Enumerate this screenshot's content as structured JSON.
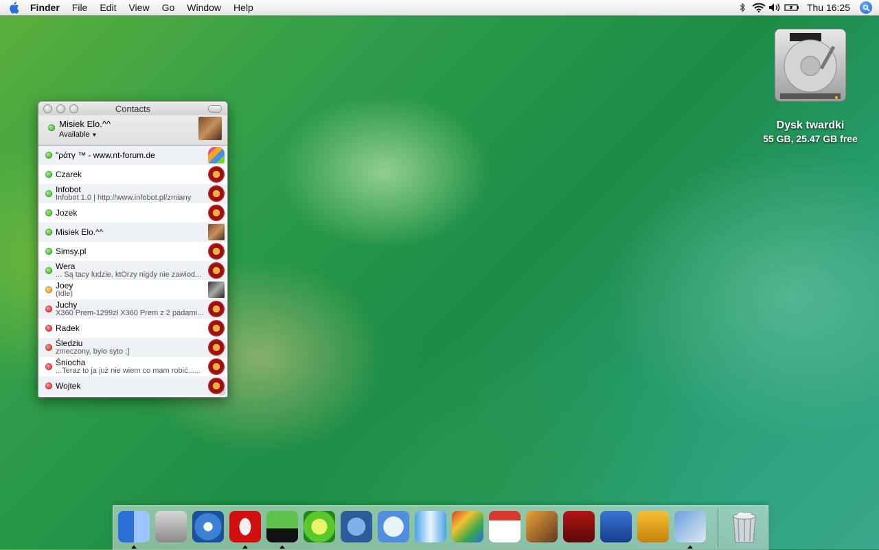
{
  "menubar": {
    "app": "Finder",
    "items": [
      "File",
      "Edit",
      "View",
      "Go",
      "Window",
      "Help"
    ],
    "clock": "Thu 16:25",
    "status_icons": [
      "bluetooth-icon",
      "wifi-icon",
      "volume-icon",
      "battery-icon"
    ]
  },
  "desktop": {
    "disk_label": "Dysk twardki",
    "disk_info": "55 GB, 25.47 GB free"
  },
  "contacts": {
    "title": "Contacts",
    "me": {
      "name": "Misiek Elo.^^",
      "status": "Available"
    },
    "list": [
      {
        "name": "\"ράτγ ™ - www.nt-forum.de",
        "msg": "",
        "status": "green",
        "icon": "butterfly"
      },
      {
        "name": "Czarek",
        "msg": "",
        "status": "green",
        "icon": "flower"
      },
      {
        "name": "Infobot",
        "msg": "Infobot 1.0 | http://www.infobot.pl/zmiany",
        "status": "green",
        "icon": "flower"
      },
      {
        "name": "Jozek",
        "msg": "",
        "status": "green",
        "icon": "flower"
      },
      {
        "name": "Misiek Elo.^^",
        "msg": "",
        "status": "green",
        "icon": "photo-a"
      },
      {
        "name": "Simsy.pl",
        "msg": "",
        "status": "green",
        "icon": "flower"
      },
      {
        "name": "Wera",
        "msg": "... Są tacy ludzie, ktÓrzy nigdy nie zawiod...",
        "status": "green",
        "icon": "flower"
      },
      {
        "name": "Joey",
        "msg": "(Idle)",
        "status": "yellow",
        "icon": "photo-b"
      },
      {
        "name": "Juchy",
        "msg": "X360 Prem-1299zł X360 Prem z 2 padami...",
        "status": "red",
        "icon": "flower"
      },
      {
        "name": "Radek",
        "msg": "",
        "status": "red",
        "icon": "flower"
      },
      {
        "name": "Śledziu",
        "msg": "zmeczony, było syto ;]",
        "status": "red",
        "icon": "flower"
      },
      {
        "name": "Śniocha",
        "msg": "...Teraz to ja już nie wiem co mam robić......",
        "status": "red",
        "icon": "flower"
      },
      {
        "name": "Wojtek",
        "msg": "",
        "status": "red",
        "icon": "flower"
      }
    ]
  },
  "dock": {
    "items": [
      {
        "name": "finder",
        "running": true,
        "bg": "linear-gradient(90deg,#2c6fd6 50%,#9cc6ff 50%)"
      },
      {
        "name": "preview",
        "running": false,
        "bg": "linear-gradient(#d8d8d8,#8a8a8a)"
      },
      {
        "name": "safari",
        "running": false,
        "bg": "radial-gradient(circle,#ffffff 0 20%,#3b82d6 21% 60%,#1d4f9a 61%)"
      },
      {
        "name": "opera",
        "running": true,
        "bg": "radial-gradient(ellipse 30% 45% at 50% 50%,#f0f0f0 0 60%,#d10f0f 61% 100%)"
      },
      {
        "name": "adium",
        "running": true,
        "bg": "linear-gradient(#5fc24a 0 55%,#111 55%)"
      },
      {
        "name": "limewire",
        "running": false,
        "bg": "radial-gradient(circle,#e8f56a 0 35%,#5ac82a 36% 70%,#1e8a1e 71%)"
      },
      {
        "name": "automator-gears",
        "running": false,
        "bg": "radial-gradient(circle,#7fb2e8 0 40%,#2c5d9a 41%)"
      },
      {
        "name": "itunes",
        "running": false,
        "bg": "radial-gradient(circle,#e9f3ff 0 45%,#4f8fe0 46%)"
      },
      {
        "name": "fish",
        "running": false,
        "bg": "linear-gradient(90deg,#4aa3e8,#e8f5ff,#4aa3e8)"
      },
      {
        "name": "display",
        "running": false,
        "bg": "linear-gradient(135deg,#e03a2a,#f2c230,#3aa84a,#2a6ae0)"
      },
      {
        "name": "ical",
        "running": false,
        "bg": "linear-gradient(#d8382e 0 30%,#ffffff 30%)"
      },
      {
        "name": "iphoto",
        "running": false,
        "bg": "linear-gradient(135deg,#f2a03a,#5a3a20)"
      },
      {
        "name": "photo-booth",
        "running": false,
        "bg": "linear-gradient(#b51414,#5a0808)"
      },
      {
        "name": "w-app",
        "running": false,
        "bg": "linear-gradient(#3a74d8,#163e8a)"
      },
      {
        "name": "transmit-truck",
        "running": false,
        "bg": "linear-gradient(#f5c030,#c88010)"
      },
      {
        "name": "preview-photos",
        "running": true,
        "bg": "linear-gradient(135deg,#6aa0e0,#e0e8f0)"
      }
    ]
  },
  "colors": {
    "accent": "#1d5fd1"
  }
}
